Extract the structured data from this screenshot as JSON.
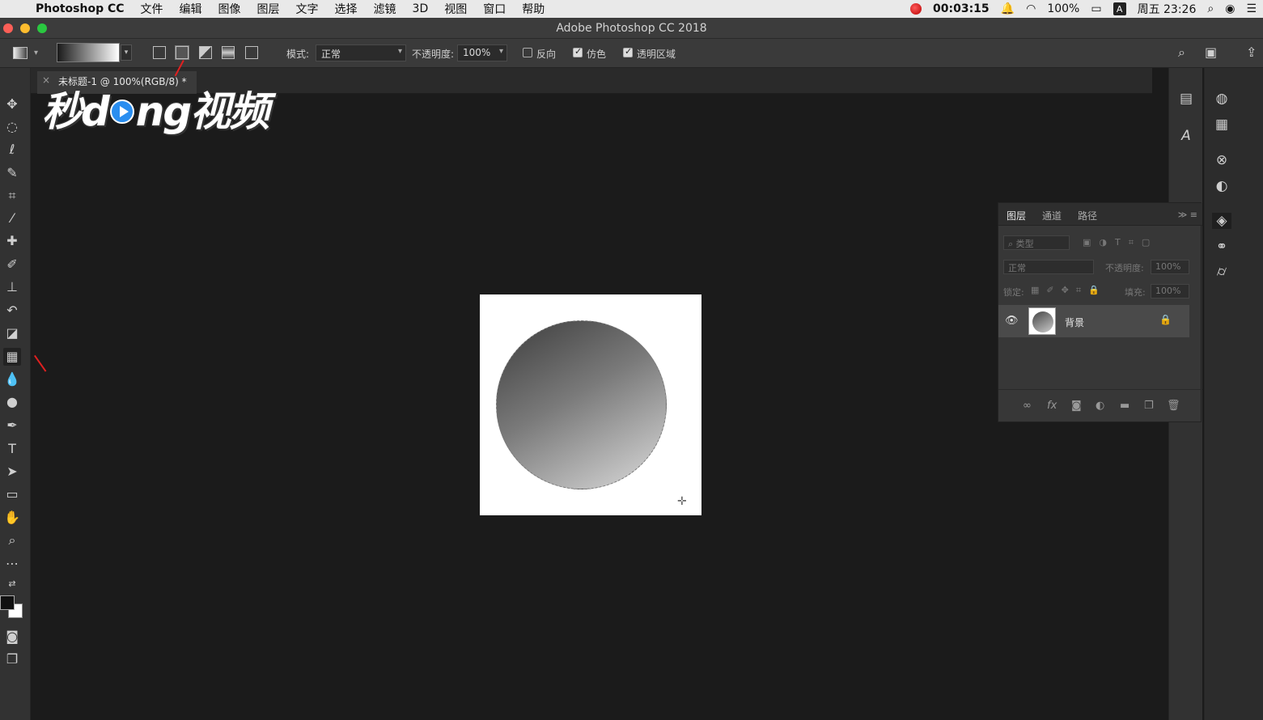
{
  "menubar": {
    "app_name": "Photoshop CC",
    "items": [
      "文件",
      "编辑",
      "图像",
      "图层",
      "文字",
      "选择",
      "滤镜",
      "3D",
      "视图",
      "窗口",
      "帮助"
    ],
    "record_time": "00:03:15",
    "battery": "100%",
    "input_method": "A",
    "clock": "周五 23:26"
  },
  "window": {
    "title": "Adobe Photoshop CC 2018"
  },
  "options": {
    "mode_label": "模式:",
    "mode_value": "正常",
    "opacity_label": "不透明度:",
    "opacity_value": "100%",
    "reverse_label": "反向",
    "dither_label": "仿色",
    "transparency_label": "透明区域"
  },
  "document": {
    "tab_title": "未标题-1 @ 100%(RGB/8) *"
  },
  "watermark": {
    "text_a": "秒d",
    "text_b": "ng视频"
  },
  "layers_panel": {
    "tabs": [
      "图层",
      "通道",
      "路径"
    ],
    "filter_placeholder": "类型",
    "blend_mode": "正常",
    "opacity_label": "不透明度:",
    "opacity_value": "100%",
    "lock_label": "锁定:",
    "fill_label": "填充:",
    "fill_value": "100%",
    "layer_name": "背景"
  },
  "colors": {
    "foreground": "#111111",
    "background": "#ffffff",
    "panel": "#373737"
  }
}
